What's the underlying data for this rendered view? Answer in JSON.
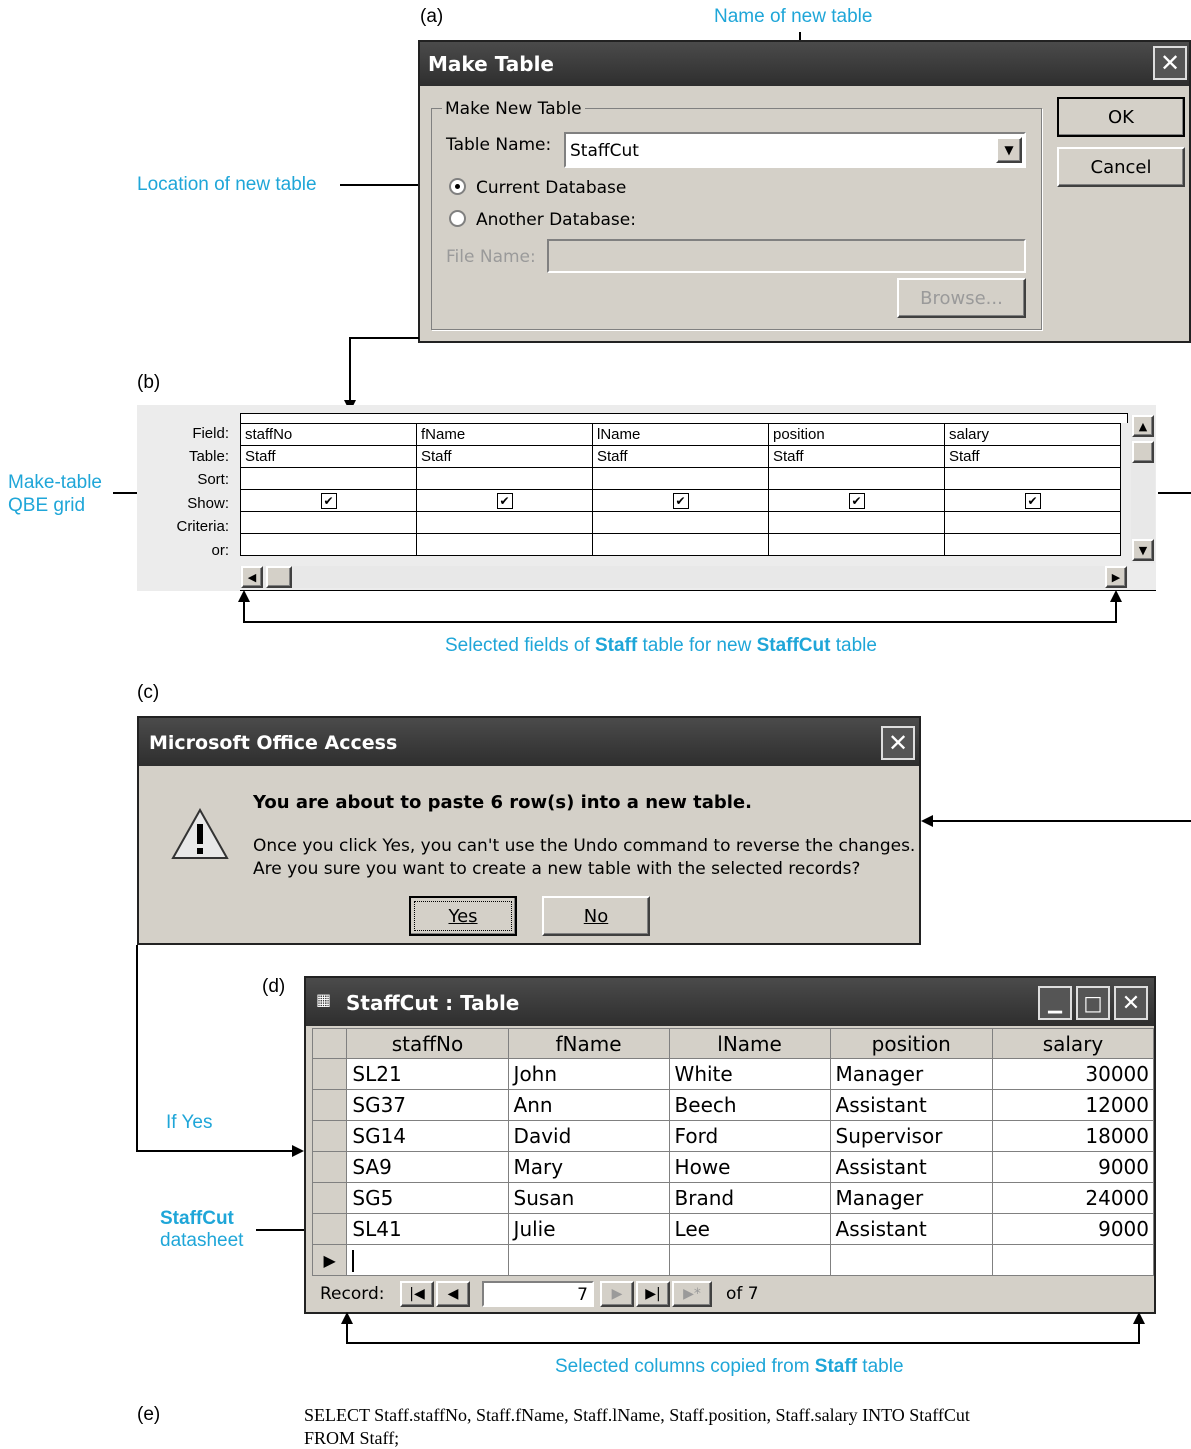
{
  "captions": {
    "a": "(a)",
    "b": "(b)",
    "c": "(c)",
    "d": "(d)",
    "e": "(e)"
  },
  "annotations": {
    "name_new_table": "Name of new table",
    "location_new_table": "Location of new table",
    "make_table_grid_1": "Make-table",
    "make_table_grid_2": "QBE grid",
    "selected_fields_pre": "Selected fields of ",
    "selected_fields_staff": "Staff",
    "selected_fields_mid": " table for new ",
    "selected_fields_staffcut": "StaffCut",
    "selected_fields_post": " table",
    "if_yes": "If Yes",
    "staffcut_label": "StaffCut",
    "datasheet_label": "datasheet",
    "selected_columns_pre": "Selected columns copied from ",
    "selected_columns_staff": "Staff",
    "selected_columns_post": " table"
  },
  "make_table": {
    "title": "Make Table",
    "group_label": "Make New Table",
    "table_name_label": "Table Name:",
    "table_name_value": "StaffCut",
    "radio_current": "Current Database",
    "radio_another": "Another Database:",
    "file_name_label": "File Name:",
    "browse_label": "Browse...",
    "ok_label": "OK",
    "cancel_label": "Cancel"
  },
  "qbe": {
    "row_labels": [
      "Field:",
      "Table:",
      "Sort:",
      "Show:",
      "Criteria:",
      "or:"
    ],
    "fields": [
      "staffNo",
      "fName",
      "lName",
      "position",
      "salary"
    ],
    "tables": [
      "Staff",
      "Staff",
      "Staff",
      "Staff",
      "Staff"
    ],
    "show": [
      true,
      true,
      true,
      true,
      true
    ]
  },
  "confirm": {
    "title": "Microsoft Office Access",
    "heading": "You are about to paste 6 row(s) into a new table.",
    "line1": "Once you click Yes, you can't use the Undo command to reverse the changes.",
    "line2": "Are you sure you want to create a new table with the selected records?",
    "yes_label": "Yes",
    "no_label": "No"
  },
  "datasheet": {
    "title": "StaffCut : Table",
    "columns": [
      "staffNo",
      "fName",
      "lName",
      "position",
      "salary"
    ],
    "rows": [
      [
        "SL21",
        "John",
        "White",
        "Manager",
        "30000"
      ],
      [
        "SG37",
        "Ann",
        "Beech",
        "Assistant",
        "12000"
      ],
      [
        "SG14",
        "David",
        "Ford",
        "Supervisor",
        "18000"
      ],
      [
        "SA9",
        "Mary",
        "Howe",
        "Assistant",
        "9000"
      ],
      [
        "SG5",
        "Susan",
        "Brand",
        "Manager",
        "24000"
      ],
      [
        "SL41",
        "Julie",
        "Lee",
        "Assistant",
        "9000"
      ]
    ],
    "record_label": "Record:",
    "record_current": "7",
    "record_of": "of  7"
  },
  "sql": {
    "line1": "SELECT Staff.staffNo, Staff.fName, Staff.lName, Staff.position, Staff.salary INTO StaffCut",
    "line2": "FROM Staff;"
  },
  "colors": {
    "annotation": "#1fa6d8",
    "dialog_bg": "#d4d0c8",
    "titlebar": "#3a3a3a"
  }
}
